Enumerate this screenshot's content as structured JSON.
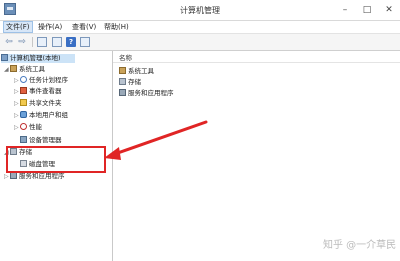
{
  "window": {
    "title": "计算机管理"
  },
  "menu": [
    {
      "label": "文件(F)",
      "active": true
    },
    {
      "label": "操作(A)"
    },
    {
      "label": "查看(V)"
    },
    {
      "label": "帮助(H)"
    }
  ],
  "tree": {
    "root": "计算机管理(本地)",
    "items": {
      "system_tools": "系统工具",
      "task_scheduler": "任务计划程序",
      "event_viewer": "事件查看器",
      "shared_folders": "共享文件夹",
      "local_users": "本地用户和组",
      "performance": "性能",
      "device_manager": "设备管理器",
      "storage": "存储",
      "disk_management": "磁盘管理",
      "services_apps": "服务和应用程序"
    }
  },
  "list": {
    "header": "名称",
    "rows": [
      "系统工具",
      "存储",
      "服务和应用程序"
    ]
  },
  "watermark": "知乎 @一介草民",
  "colors": {
    "highlight": "#e02525",
    "selection": "#cce3f7"
  }
}
